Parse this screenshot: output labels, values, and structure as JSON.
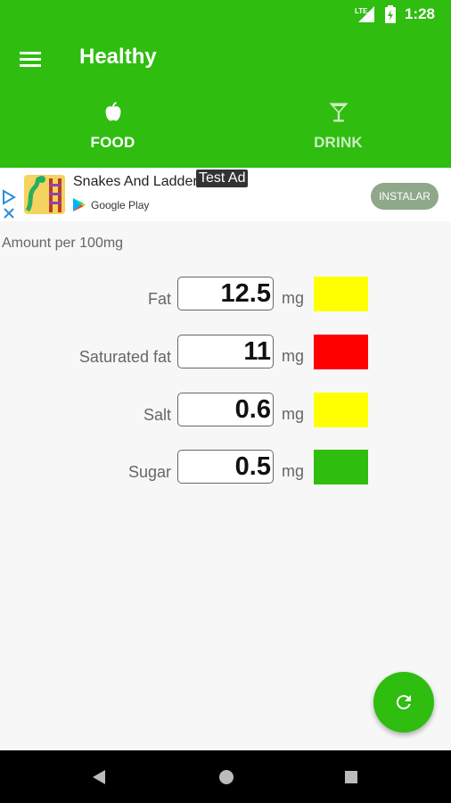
{
  "status": {
    "time": "1:28",
    "network": "LTE"
  },
  "app": {
    "title": "Healthy"
  },
  "tabs": [
    {
      "label": "FOOD",
      "icon": "apple-icon",
      "active": true
    },
    {
      "label": "DRINK",
      "icon": "cocktail-icon",
      "active": false
    }
  ],
  "ad": {
    "title": "Snakes And Ladders",
    "badge": "Test Ad",
    "store": "Google Play",
    "install": "INSTALAR"
  },
  "amount_label": "Amount per 100mg",
  "nutrients": [
    {
      "label": "Fat",
      "value": "12.5",
      "unit": "mg",
      "color": "#ffff00"
    },
    {
      "label": "Saturated fat",
      "value": "11",
      "unit": "mg",
      "color": "#ff0000"
    },
    {
      "label": "Salt",
      "value": "0.6",
      "unit": "mg",
      "color": "#ffff00"
    },
    {
      "label": "Sugar",
      "value": "0.5",
      "unit": "mg",
      "color": "#2fbd10"
    }
  ],
  "colors": {
    "primary": "#2fbd10"
  }
}
